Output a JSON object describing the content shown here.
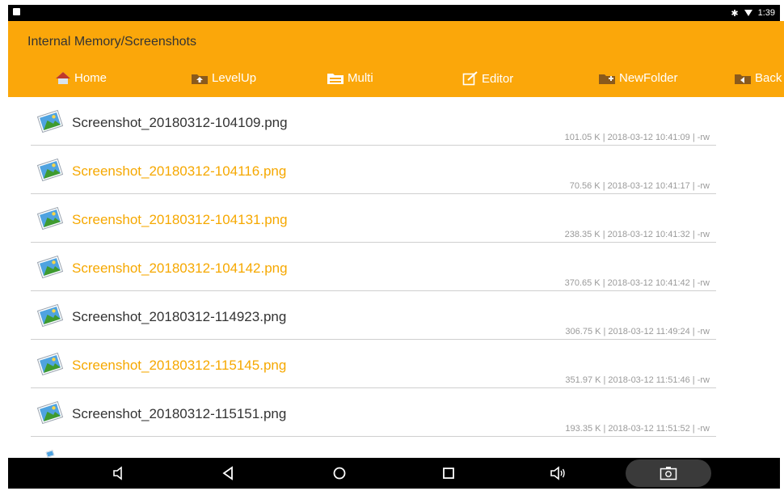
{
  "status_bar": {
    "time": "1:39",
    "bluetooth_icon": "bluetooth-icon",
    "wifi_icon": "wifi-icon",
    "notification_icon": "image-notification-icon"
  },
  "header": {
    "path": "Internal Memory/Screenshots",
    "color": "#fba70a"
  },
  "toolbar": {
    "items": [
      {
        "label": "Home",
        "icon": "home-icon"
      },
      {
        "label": "LevelUp",
        "icon": "folder-up-icon"
      },
      {
        "label": "Multi",
        "icon": "multi-select-icon"
      },
      {
        "label": "Editor",
        "icon": "edit-icon"
      },
      {
        "label": "NewFolder",
        "icon": "new-folder-icon"
      },
      {
        "label": "Back",
        "icon": "folder-back-icon"
      }
    ]
  },
  "files": [
    {
      "name": "Screenshot_20180312-104109.png",
      "meta": "101.05 K | 2018-03-12 10:41:09 | -rw",
      "selected": false
    },
    {
      "name": "Screenshot_20180312-104116.png",
      "meta": "70.56 K | 2018-03-12 10:41:17 | -rw",
      "selected": true
    },
    {
      "name": "Screenshot_20180312-104131.png",
      "meta": "238.35 K | 2018-03-12 10:41:32 | -rw",
      "selected": true
    },
    {
      "name": "Screenshot_20180312-104142.png",
      "meta": "370.65 K | 2018-03-12 10:41:42 | -rw",
      "selected": true
    },
    {
      "name": "Screenshot_20180312-114923.png",
      "meta": "306.75 K | 2018-03-12 11:49:24 | -rw",
      "selected": false
    },
    {
      "name": "Screenshot_20180312-115145.png",
      "meta": "351.97 K | 2018-03-12 11:51:46 | -rw",
      "selected": true
    },
    {
      "name": "Screenshot_20180312-115151.png",
      "meta": "193.35 K | 2018-03-12 11:51:52 | -rw",
      "selected": false
    }
  ],
  "selected_color": "#f6a800",
  "nav_bar": {
    "buttons": [
      "volume-down-icon",
      "back-icon",
      "home-circle-icon",
      "recents-icon",
      "volume-up-icon",
      "screenshot-icon"
    ]
  }
}
